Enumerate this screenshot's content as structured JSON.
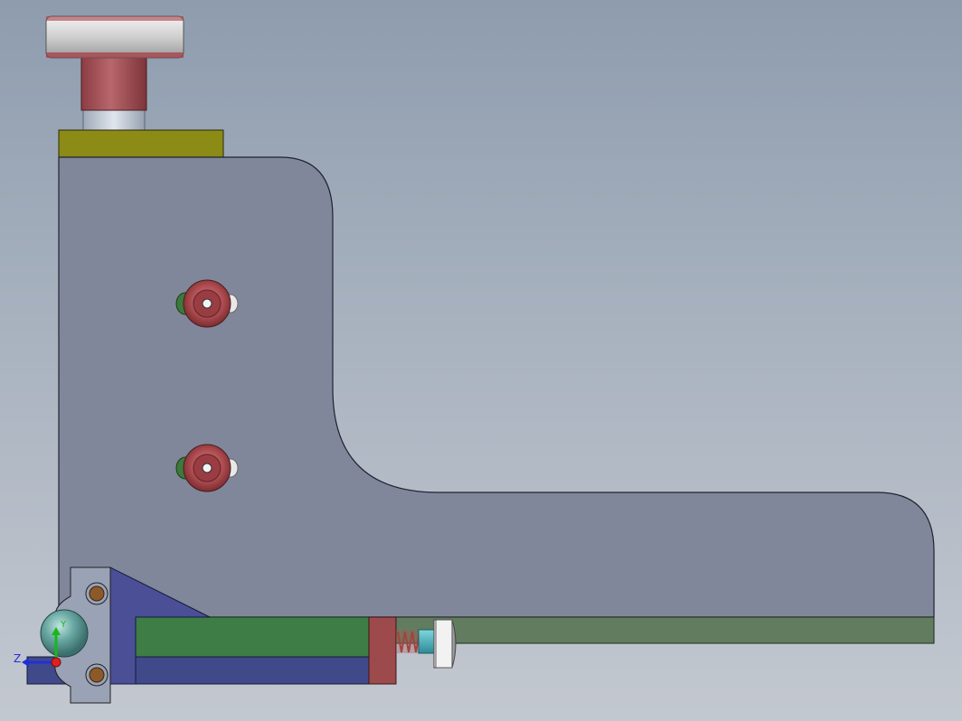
{
  "viewport": {
    "background_top": "#8e9cae",
    "background_bottom": "#c3c8d0"
  },
  "colors": {
    "bracket_body": "#80879a",
    "bracket_outline": "#1f2230",
    "top_plate": "#8b8b16",
    "knob_cap": "#d8d8d8",
    "knob_stem": "#a35257",
    "knob_shaft": "#b9c4d2",
    "screw_washer": "#b85558",
    "screw_hole": "#f4f4f4",
    "pin_green": "#3d7a3a",
    "rail_green": "#3e7d45",
    "rail_light_green": "#627c5f",
    "base_blue": "#404a8a",
    "support_blue": "#4a4f96",
    "mount_plate": "#9aa2b6",
    "mount_hole": "#8c5a2a",
    "end_block": "#9c4a4c",
    "spring": "#b05a55",
    "thumb_screw": "#d7d7d7",
    "thumb_screw_cyan": "#4fb9c4",
    "ball_knob": "#6aa8a3"
  },
  "triad": {
    "x_label": "",
    "y_label": "Y",
    "z_label": "Z",
    "x_color": "#e02020",
    "y_color": "#18b818",
    "z_color": "#2030d8"
  }
}
